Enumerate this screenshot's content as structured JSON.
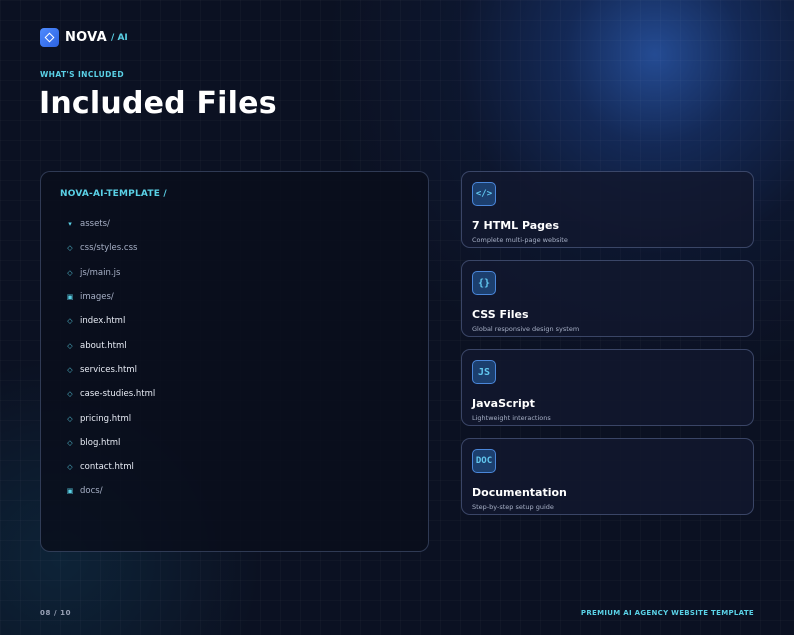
{
  "brand": {
    "name": "NOVA",
    "suffix": "/ AI",
    "logo_icon": "diamond-icon"
  },
  "header": {
    "eyebrow": "WHAT'S INCLUDED",
    "title": "Included Files"
  },
  "tree": {
    "root": "NOVA-AI-TEMPLATE /",
    "items": [
      {
        "icon": "▾",
        "icon_name": "caret-down-icon",
        "label": "assets/",
        "style": "dim"
      },
      {
        "icon": "◇",
        "icon_name": "file-icon",
        "label": "css/styles.css",
        "style": "dim"
      },
      {
        "icon": "◇",
        "icon_name": "file-icon",
        "label": "js/main.js",
        "style": "dim"
      },
      {
        "icon": "▣",
        "icon_name": "folder-icon",
        "label": "images/",
        "style": "dim"
      },
      {
        "icon": "◇",
        "icon_name": "file-icon",
        "label": "index.html",
        "style": "bright"
      },
      {
        "icon": "◇",
        "icon_name": "file-icon",
        "label": "about.html",
        "style": "bright"
      },
      {
        "icon": "◇",
        "icon_name": "file-icon",
        "label": "services.html",
        "style": "bright"
      },
      {
        "icon": "◇",
        "icon_name": "file-icon",
        "label": "case-studies.html",
        "style": "bright"
      },
      {
        "icon": "◇",
        "icon_name": "file-icon",
        "label": "pricing.html",
        "style": "bright"
      },
      {
        "icon": "◇",
        "icon_name": "file-icon",
        "label": "blog.html",
        "style": "bright"
      },
      {
        "icon": "◇",
        "icon_name": "file-icon",
        "label": "contact.html",
        "style": "bright"
      },
      {
        "icon": "▣",
        "icon_name": "folder-icon",
        "label": "docs/",
        "style": "dim"
      }
    ]
  },
  "cards": [
    {
      "icon": "</>",
      "icon_name": "code-icon",
      "title": "7 HTML Pages",
      "desc": "Complete multi-page website"
    },
    {
      "icon": "{}",
      "icon_name": "braces-icon",
      "title": "CSS Files",
      "desc": "Global responsive design system"
    },
    {
      "icon": "JS",
      "icon_name": "js-icon",
      "title": "JavaScript",
      "desc": "Lightweight interactions"
    },
    {
      "icon": "DOC",
      "icon_name": "doc-icon",
      "title": "Documentation",
      "desc": "Step-by-step setup guide"
    }
  ],
  "footer": {
    "page": "08 / 10",
    "tagline": "PREMIUM AI AGENCY WEBSITE TEMPLATE"
  },
  "colors": {
    "accent": "#5ad1e6",
    "brand": "#3f7cf2",
    "background": "#0b1122"
  }
}
